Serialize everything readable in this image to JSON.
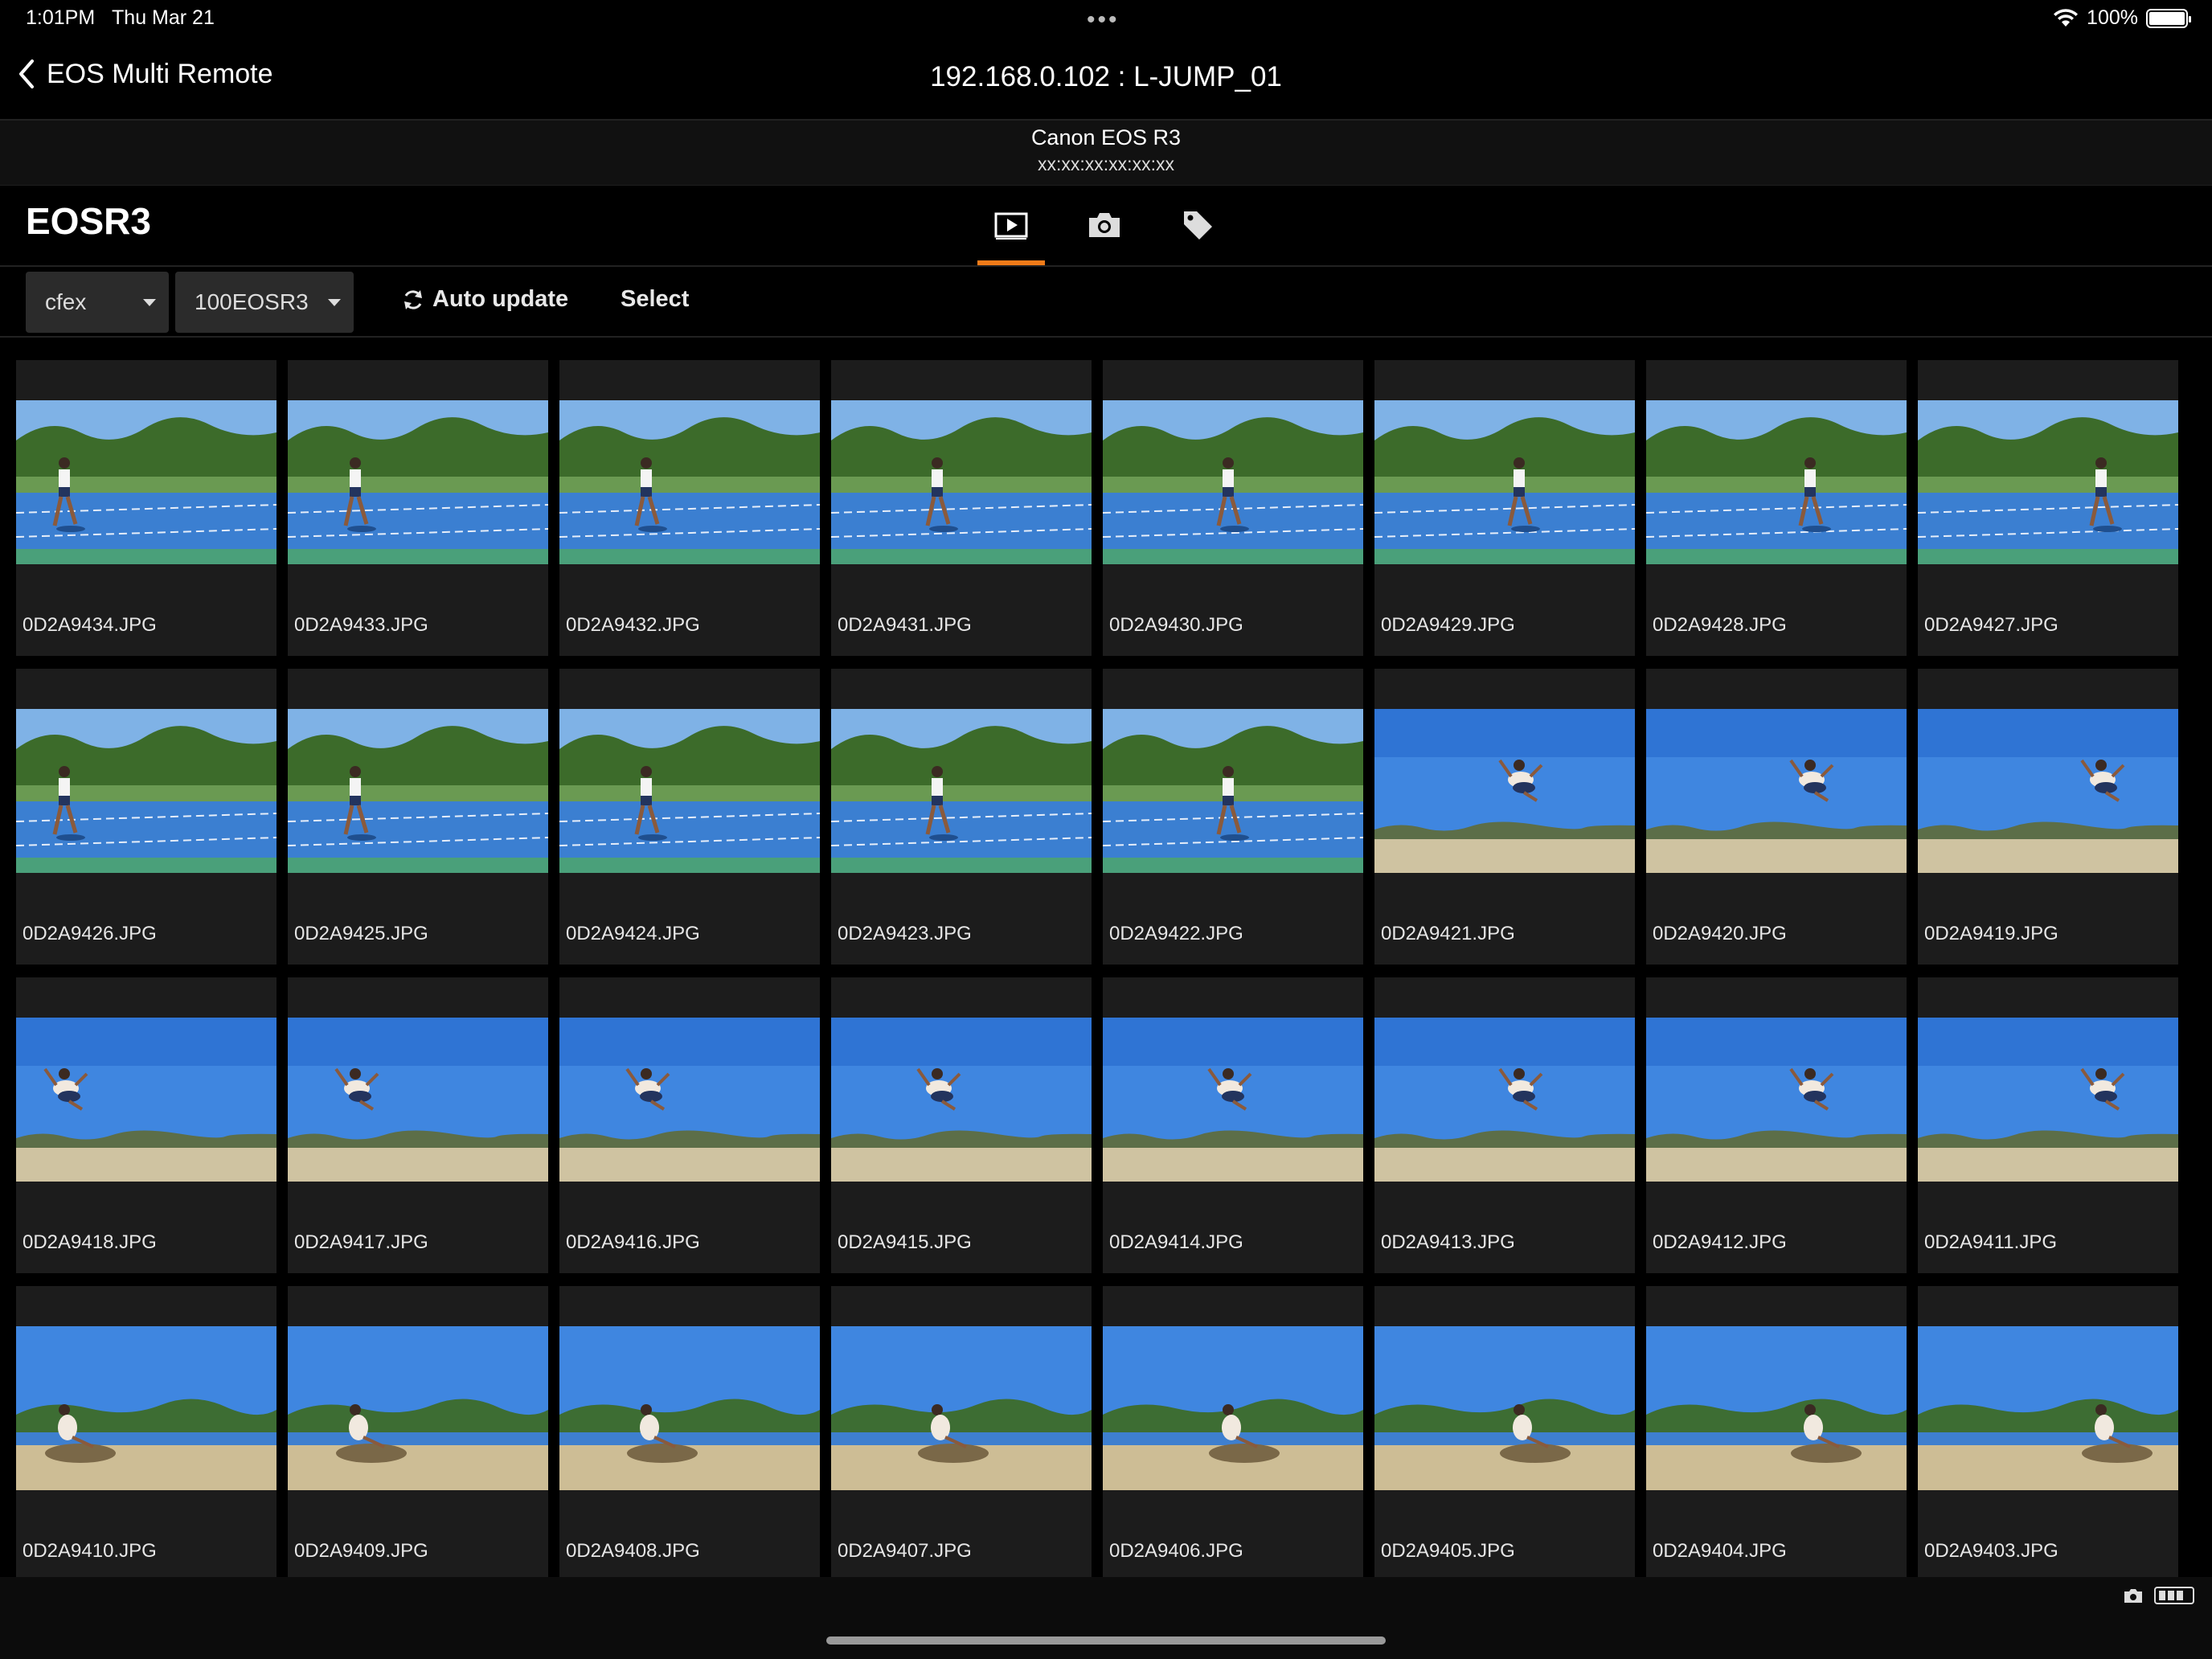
{
  "status_bar": {
    "time": "1:01PM",
    "date": "Thu Mar 21",
    "battery": "100%"
  },
  "nav": {
    "back_label": "EOS Multi Remote",
    "title": "192.168.0.102 : L-JUMP_01"
  },
  "camera": {
    "model": "Canon EOS R3",
    "mac": "xx:xx:xx:xx:xx:xx"
  },
  "header": {
    "device_name": "EOSR3"
  },
  "tabs": [
    {
      "id": "playback",
      "icon": "playback-icon",
      "active": true
    },
    {
      "id": "camera",
      "icon": "camera-icon",
      "active": false
    },
    {
      "id": "tag",
      "icon": "tag-icon",
      "active": false
    }
  ],
  "toolbar": {
    "storage": "cfex",
    "folder": "100EOSR3",
    "auto_update_label": "Auto update",
    "select_label": "Select"
  },
  "colors": {
    "accent": "#f07b19",
    "background": "#000000",
    "cell": "#1c1c1c"
  },
  "images": [
    "0D2A9434.JPG",
    "0D2A9433.JPG",
    "0D2A9432.JPG",
    "0D2A9431.JPG",
    "0D2A9430.JPG",
    "0D2A9429.JPG",
    "0D2A9428.JPG",
    "0D2A9427.JPG",
    "0D2A9426.JPG",
    "0D2A9425.JPG",
    "0D2A9424.JPG",
    "0D2A9423.JPG",
    "0D2A9422.JPG",
    "0D2A9421.JPG",
    "0D2A9420.JPG",
    "0D2A9419.JPG",
    "0D2A9418.JPG",
    "0D2A9417.JPG",
    "0D2A9416.JPG",
    "0D2A9415.JPG",
    "0D2A9414.JPG",
    "0D2A9413.JPG",
    "0D2A9412.JPG",
    "0D2A9411.JPG",
    "0D2A9410.JPG",
    "0D2A9409.JPG",
    "0D2A9408.JPG",
    "0D2A9407.JPG",
    "0D2A9406.JPG",
    "0D2A9405.JPG",
    "0D2A9404.JPG",
    "0D2A9403.JPG"
  ]
}
